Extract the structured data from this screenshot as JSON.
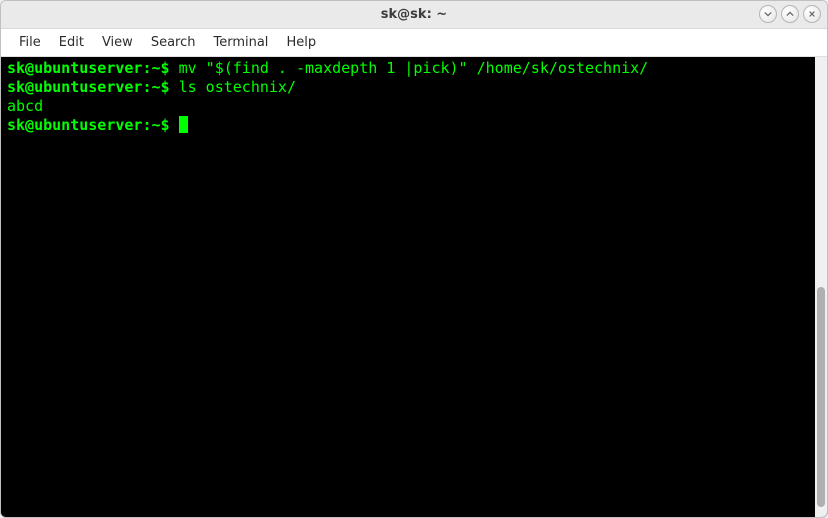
{
  "window": {
    "title": "sk@sk: ~"
  },
  "menubar": {
    "items": [
      "File",
      "Edit",
      "View",
      "Search",
      "Terminal",
      "Help"
    ]
  },
  "terminal": {
    "prompt": "sk@ubuntuserver:~$",
    "lines": [
      {
        "type": "cmd",
        "text": "mv \"$(find . -maxdepth 1 |pick)\" /home/sk/ostechnix/"
      },
      {
        "type": "cmd",
        "text": "ls ostechnix/"
      },
      {
        "type": "out",
        "text": "abcd"
      }
    ]
  },
  "colors": {
    "term_bg": "#000000",
    "term_fg": "#00ff00"
  }
}
